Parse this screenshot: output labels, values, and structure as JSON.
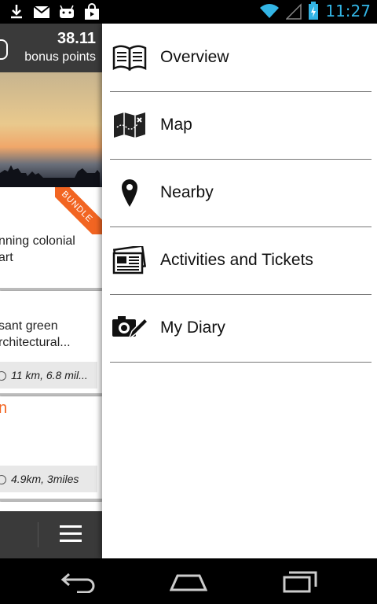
{
  "status_bar": {
    "time": "11:27",
    "icons": [
      "download-icon",
      "gmail-icon",
      "android-icon",
      "shopping-bag-icon",
      "wifi-icon",
      "signal-icon",
      "battery-icon"
    ]
  },
  "left_panel": {
    "points_value": "38.11",
    "points_label": "bonus points",
    "bundle_ribbon": "BUNDLE",
    "card1_line1": "nning colonial",
    "card1_line2": "art",
    "card2_line1": "sant green",
    "card2_line2": "rchitectural...",
    "card2_distance": "11 km, 6.8 mil...",
    "card3_title": "n",
    "card3_distance": "4.9km, 3miles"
  },
  "drawer": {
    "items": [
      {
        "label": "Overview",
        "icon": "book-icon"
      },
      {
        "label": "Map",
        "icon": "map-icon"
      },
      {
        "label": "Nearby",
        "icon": "location-pin-icon"
      },
      {
        "label": "Activities and Tickets",
        "icon": "tickets-icon"
      },
      {
        "label": "My Diary",
        "icon": "camera-pencil-icon"
      }
    ]
  },
  "colors": {
    "accent": "#f26522",
    "status_time": "#33b5e5",
    "dark_bar": "#3a3a3a"
  }
}
